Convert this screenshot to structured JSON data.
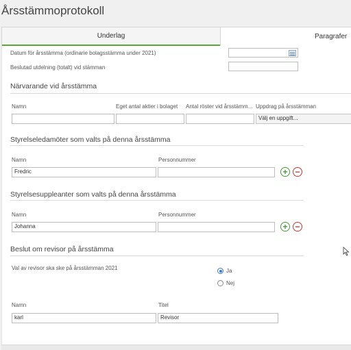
{
  "window": {
    "title": "Årsstämmoprotokoll"
  },
  "tabs": [
    {
      "label": "Underlag",
      "active": true
    },
    {
      "label": "Paragrafer",
      "active": false
    }
  ],
  "top_fields": {
    "date_label": "Datum för årsstämma (ordinarie bolagsstämma under 2021)",
    "date_value": "",
    "dividend_label": "Beslutad utdelning (totalt) vid stämman",
    "dividend_value": ""
  },
  "attendees": {
    "heading": "Närvarande vid årsstämma",
    "col_name": "Namn",
    "col_shares": "Eget antal aktier i bolaget",
    "col_votes": "Antal röster vid årsstämm...",
    "col_role": "Uppdrag på årsstämman",
    "row": {
      "name": "",
      "shares": "",
      "votes": "",
      "role": "Välj en uppgift..."
    }
  },
  "board": {
    "heading": "Styrelseledamöter som valts på denna årsstämma",
    "col_name": "Namn",
    "col_pnr": "Personnummer",
    "row": {
      "name": "Fredric",
      "pnr": ""
    }
  },
  "deputies": {
    "heading": "Styrelsesuppleanter som valts på denna årsstämma",
    "col_name": "Namn",
    "col_pnr": "Personnummer",
    "row": {
      "name": "Johanna",
      "pnr": ""
    }
  },
  "auditor": {
    "heading": "Beslut om revisor på årsstämma",
    "question": "Val av revisor ska ske på årsstämman 2021",
    "option_yes": "Ja",
    "option_no": "Nej",
    "selected": "Ja",
    "col_name": "Namn",
    "col_title": "Titel",
    "row": {
      "name": "karl",
      "title": "Revisor"
    }
  },
  "icons": {
    "calendar": "calendar-icon",
    "add": "plus-circle-icon",
    "remove": "minus-circle-icon"
  },
  "colors": {
    "active_tab_underline": "#5aa63a",
    "add_button": "#4a9a3a",
    "remove_button": "#c03838",
    "radio_selected": "#3a78c8"
  }
}
